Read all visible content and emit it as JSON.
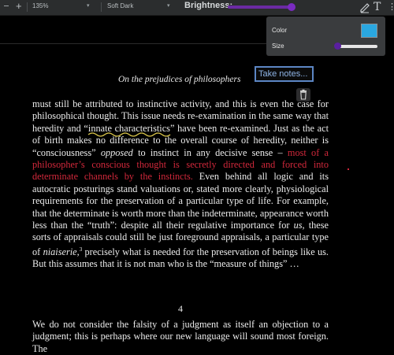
{
  "toolbar": {
    "zoom": "135%",
    "theme": "Soft Dark",
    "brightness_label": "Brightness:",
    "brightness_level": 0.95,
    "accent": "#7a2bc0",
    "icons": [
      "minus-icon",
      "plus-icon",
      "chevron-down-icon",
      "pen-icon",
      "text-tool-icon",
      "more-icon"
    ]
  },
  "popover": {
    "color_label": "Color",
    "color_value": "#2aa7e0",
    "size_label": "Size",
    "size_level": 0.05
  },
  "page": {
    "running_head": "On the prejudices of philosophers",
    "note_input": "Take notes...",
    "paragraph1": {
      "part1": "must still be attributed to instinctive activity, and this is even the case for philosophical thought. This issue needs re-examination in the same way that heredity and “",
      "highlight": "innate characteristics",
      "part2": "” have been re-examined. Just as the act of birth makes no difference to the overall course of heredity, neither is “consciousness” ",
      "opposed": "opposed",
      "part3": " to instinct in any decisive sense – ",
      "red": "most of a philosopher’s conscious thought is secretly directed and forced into determinate channels by the instincts.",
      "part4": " Even behind all logic and its autocratic posturings stand valuations or, stated more clearly, physiological requirements for the preservation of a particular type of life. For example, that the determinate is worth more than the indeterminate, appearance worth less than the “truth”: despite all their regulative importance for ",
      "us": "us",
      "part5": ", these sorts of appraisals could still be just foreground appraisals, a particular type of ",
      "niaiserie": "niaiserie",
      "fn": "3",
      "part6": " precisely what is needed for the preservation of beings like us. But this assumes that it is not man who is the “measure of things” …"
    },
    "section_number": "4",
    "paragraph2": "We do not consider the falsity of a judgment as itself an objection to a judgment; this is perhaps where our new language will sound most foreign. The",
    "highlight_color": "#d2283b"
  }
}
